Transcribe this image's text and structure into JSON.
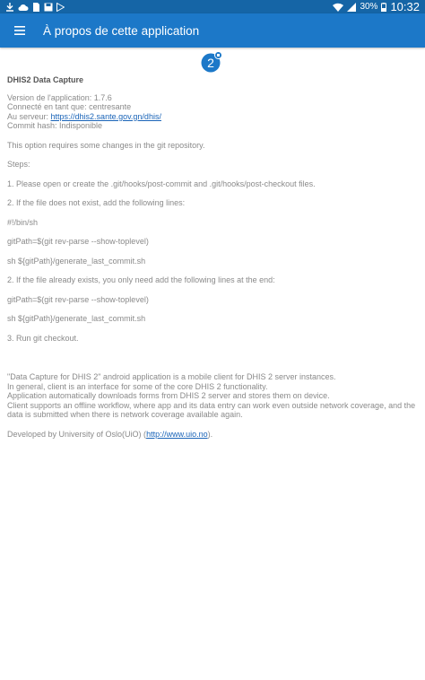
{
  "status_bar": {
    "battery": "30%",
    "time": "10:32"
  },
  "app_bar": {
    "title": "À propos de cette application"
  },
  "logo": {
    "label": "2"
  },
  "about": {
    "app_name": "DHIS2 Data Capture",
    "version": "Version de l'application: 1.7.6",
    "logged_in": "Connecté en tant que: centresante",
    "server_label": "Au serveur: ",
    "server_url": "https://dhis2.sante.gov.gn/dhis/",
    "commit_hash": "Commit hash: Indisponible",
    "git_info": [
      "This option requires some changes in the git repository.",
      "Steps:",
      "1. Please open or create the .git/hooks/post-commit and .git/hooks/post-checkout files.",
      "2. If the file does not exist, add the following lines:",
      "#!/bin/sh",
      "gitPath=$(git rev-parse --show-toplevel)",
      "sh ${gitPath}/generate_last_commit.sh",
      "2. If the file already exists, you only need add the following lines at the end:",
      "gitPath=$(git rev-parse --show-toplevel)",
      "sh ${gitPath}/generate_last_commit.sh",
      "3. Run git checkout."
    ],
    "description": [
      "\"Data Capture for DHIS 2\" android application is a mobile client for DHIS 2 server instances.",
      "In general, client is an interface for some of the core DHIS 2 functionality.",
      "Application automatically downloads forms from DHIS 2 server and stores them on device.",
      "Client supports an offline workflow, where app and its data entry can work even outside network coverage, and the data is submitted when there is network coverage available again."
    ],
    "developed_prefix": "Developed by University of Oslo(UiO) (",
    "developed_url": "http://www.uio.no",
    "developed_suffix": ")."
  }
}
